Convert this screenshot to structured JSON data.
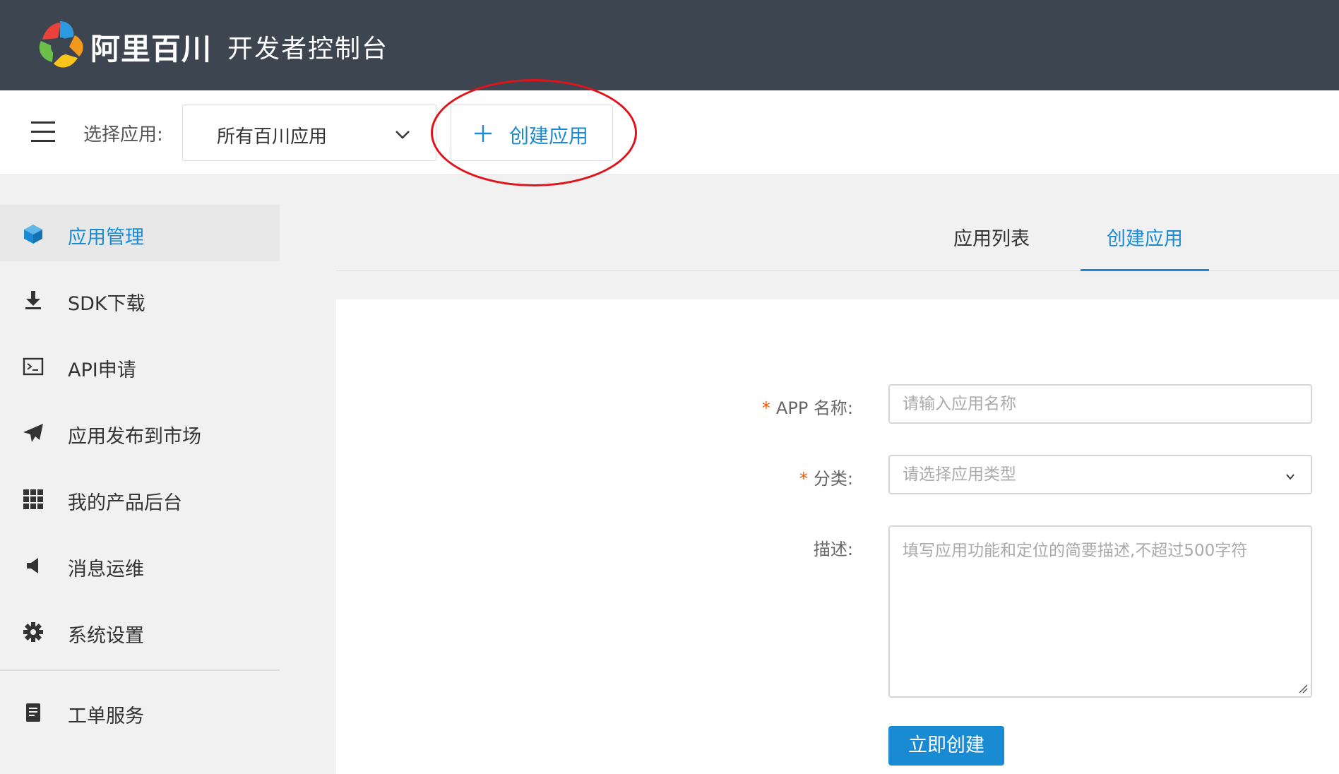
{
  "header": {
    "brand": "阿里百川",
    "console_title": "开发者控制台"
  },
  "toolbar": {
    "select_label": "选择应用:",
    "selected_app": "所有百川应用",
    "create_app_label": "创建应用"
  },
  "sidebar": {
    "items": [
      {
        "label": "应用管理",
        "icon": "cube-icon",
        "active": true
      },
      {
        "label": "SDK下载",
        "icon": "download-icon"
      },
      {
        "label": "API申请",
        "icon": "terminal-icon"
      },
      {
        "label": "应用发布到市场",
        "icon": "paper-plane-icon"
      },
      {
        "label": "我的产品后台",
        "icon": "grid-icon"
      },
      {
        "label": "消息运维",
        "icon": "megaphone-icon"
      },
      {
        "label": "系统设置",
        "icon": "gear-icon"
      },
      {
        "label": "工单服务",
        "icon": "document-icon"
      }
    ]
  },
  "tabs": [
    {
      "label": "应用列表"
    },
    {
      "label": "创建应用",
      "active": true
    }
  ],
  "form": {
    "app_name_label": "APP 名称:",
    "app_name_placeholder": "请输入应用名称",
    "category_label": "分类:",
    "category_placeholder": "请选择应用类型",
    "description_label": "描述:",
    "description_placeholder": "填写应用功能和定位的简要描述,不超过500字符",
    "required_mark": "*",
    "submit_label": "立即创建"
  },
  "colors": {
    "header_bg": "#3d4551",
    "accent": "#1a8bd3",
    "required": "#f05a00",
    "annotation": "#e0131b"
  }
}
